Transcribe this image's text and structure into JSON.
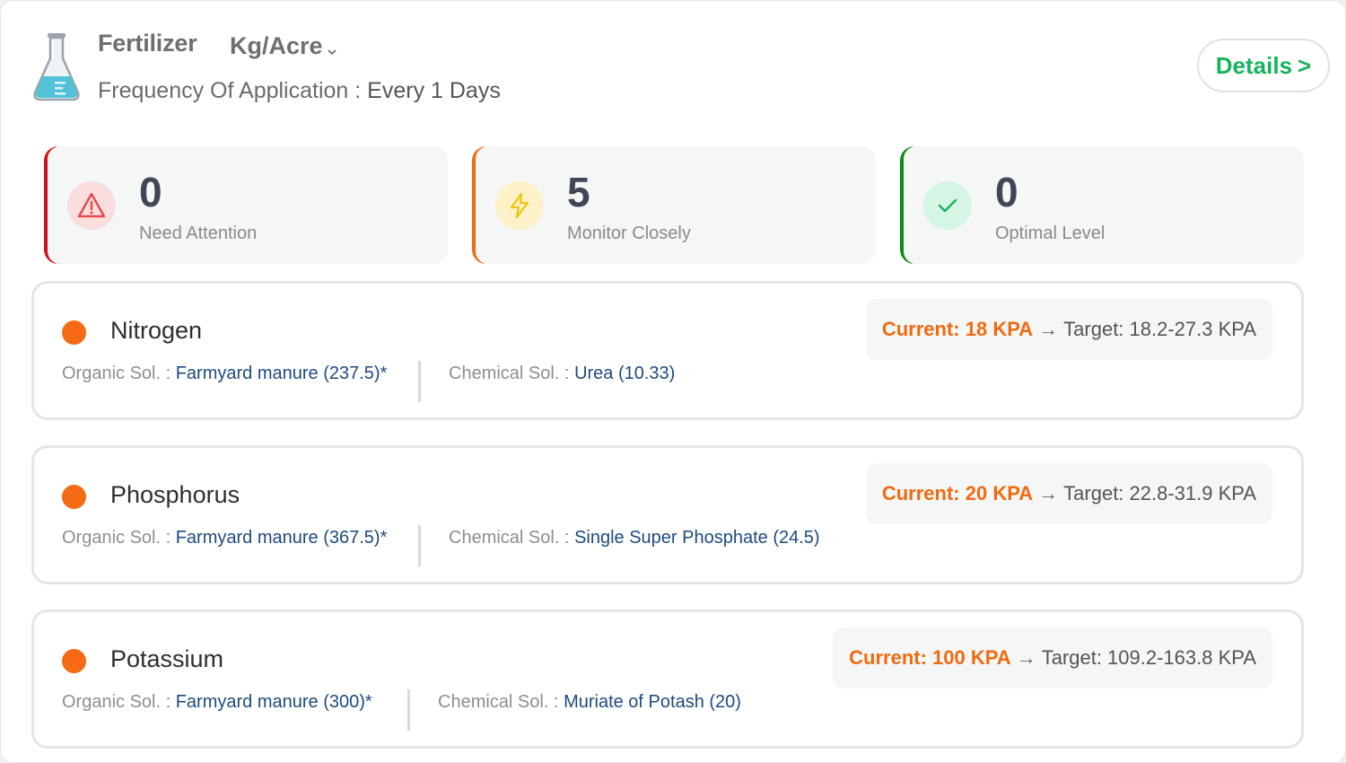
{
  "header": {
    "title": "Fertilizer",
    "unit": "Kg/Acre",
    "frequency_label": "Frequency Of Application : ",
    "frequency_value": "Every 1 Days",
    "details_label": "Details",
    "details_arrow": ">"
  },
  "stats": [
    {
      "count": "0",
      "label": "Need Attention",
      "icon": "warning-triangle-icon",
      "accent": "#d01111"
    },
    {
      "count": "5",
      "label": "Monitor Closely",
      "icon": "lightning-bolt-icon",
      "accent": "#f26b12"
    },
    {
      "count": "0",
      "label": "Optimal Level",
      "icon": "checkmark-icon",
      "accent": "#0a8a17"
    }
  ],
  "nutrients": [
    {
      "name": "Nitrogen",
      "organic_label": "Organic Sol. : ",
      "organic_value": "Farmyard manure (237.5)*",
      "chemical_label": "Chemical Sol. : ",
      "chemical_value": "Urea (10.33)",
      "current": "Current: 18 KPA",
      "arrow": "→",
      "target": "Target: 18.2-27.3 KPA"
    },
    {
      "name": "Phosphorus",
      "organic_label": "Organic Sol. : ",
      "organic_value": "Farmyard manure (367.5)*",
      "chemical_label": "Chemical Sol. : ",
      "chemical_value": "Single Super Phosphate (24.5)",
      "current": "Current: 20 KPA",
      "arrow": "→",
      "target": "Target: 22.8-31.9 KPA"
    },
    {
      "name": "Potassium",
      "organic_label": "Organic Sol. : ",
      "organic_value": "Farmyard manure (300)*",
      "chemical_label": "Chemical Sol. : ",
      "chemical_value": "Muriate of Potash (20)",
      "current": "Current: 100 KPA",
      "arrow": "→",
      "target": "Target: 109.2-163.8 KPA"
    }
  ],
  "colors": {
    "accent_green": "#16b35b",
    "status_orange": "#f56a14",
    "solution_value": "#1d4a80"
  }
}
